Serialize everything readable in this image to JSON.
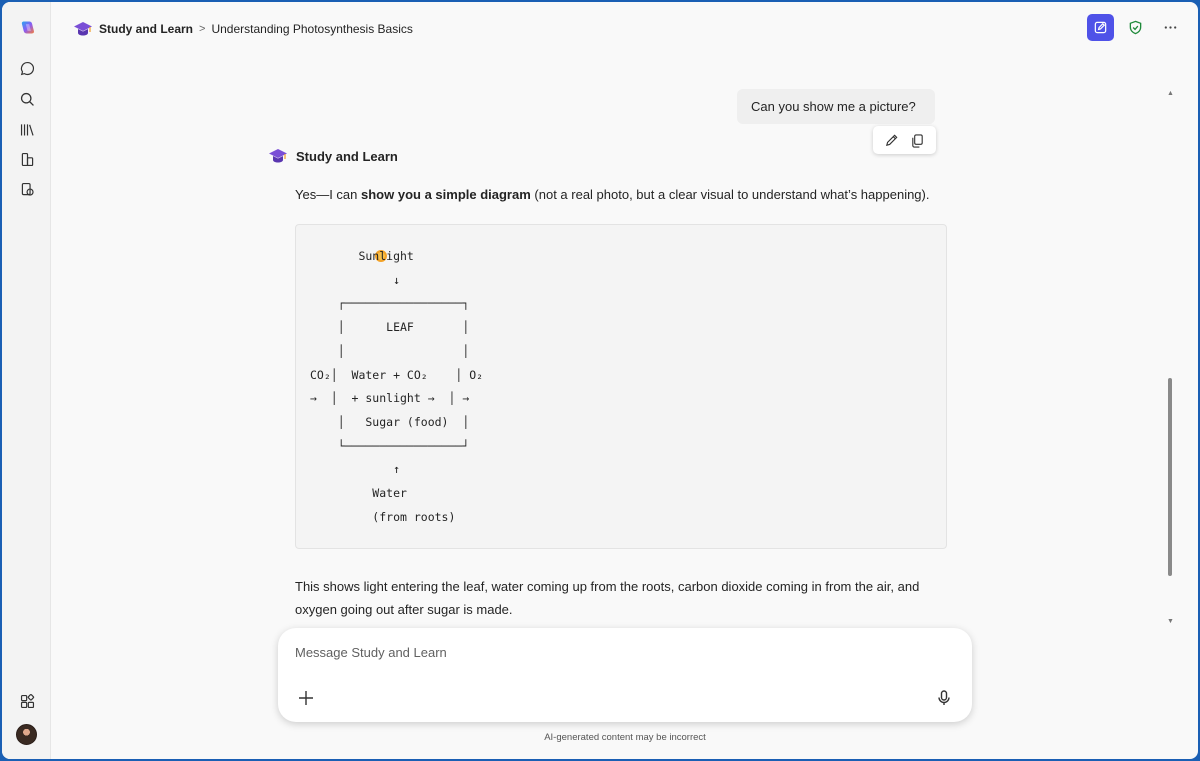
{
  "header": {
    "app_name": "Study and Learn",
    "separator": ">",
    "chat_title": "Understanding Photosynthesis Basics"
  },
  "conversation": {
    "user_message": "Can you show me a picture?",
    "bot_name": "Study and Learn",
    "intro_prefix": "Yes—I can ",
    "intro_bold": "show you a simple diagram",
    "intro_suffix": " (not a real photo, but a clear visual to understand what’s happening).",
    "diagram_lines": [
      "       Sunlight",
      "            ↓",
      "    ┌─────────────────┐",
      "    │      LEAF       │",
      "    │                 │",
      "CO₂│  Water + CO₂    │ O₂",
      "→  │  + sunlight →  │ →",
      "    │   Sugar (food)  │",
      "    └─────────────────┘",
      "            ↑",
      "         Water",
      "         (from roots)"
    ],
    "explanation": "This shows light entering the leaf, water coming up from the roots, carbon dioxide coming in from the air, and oxygen going out after sugar is made."
  },
  "composer": {
    "placeholder": "Message Study and Learn"
  },
  "disclaimer": "AI-generated content may be incorrect",
  "icons": {
    "logo": "copilot-logo-icon",
    "chat": "chat-icon",
    "search": "search-icon",
    "library": "library-icon",
    "notebooks": "notebook-icon",
    "pages": "pages-icon",
    "apps": "apps-icon",
    "new_chat": "new-chat-icon",
    "shield": "shield-check-icon",
    "more": "more-icon",
    "edit": "edit-icon",
    "copy": "copy-icon",
    "add": "plus-icon",
    "mic": "microphone-icon"
  },
  "colors": {
    "accent": "#4f52e8",
    "shield": "#1f8a3a",
    "cap_purple": "#7a4fd6"
  }
}
